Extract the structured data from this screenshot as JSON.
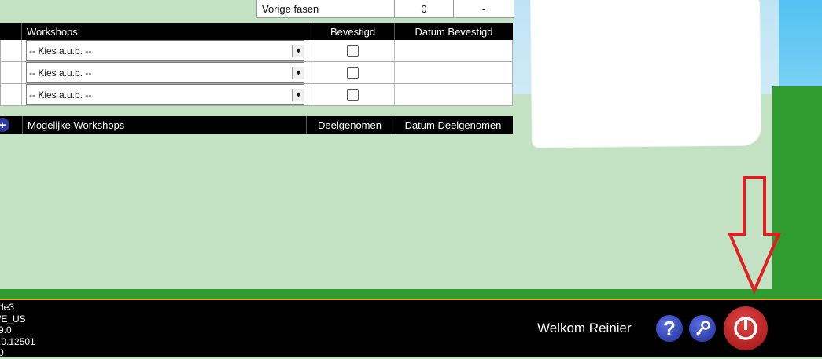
{
  "top_table": {
    "label": "Vorige fasen",
    "count": "0",
    "date": "-"
  },
  "workshops_table": {
    "headers": [
      "Workshops",
      "Bevestigd",
      "Datum Bevestigd"
    ],
    "rows": [
      {
        "select": "-- Kies a.u.b. --",
        "confirmed": false,
        "date": ""
      },
      {
        "select": "-- Kies a.u.b. --",
        "confirmed": false,
        "date": ""
      },
      {
        "select": "-- Kies a.u.b. --",
        "confirmed": false,
        "date": ""
      }
    ]
  },
  "possible_table": {
    "add_icon": "plus-icon",
    "headers": [
      "Mogelijke Workshops",
      "Deelgenomen",
      "Datum Deelgenomen"
    ]
  },
  "footer": {
    "version_lines": [
      "de3",
      "/E_US",
      "9.0",
      ".0.12501",
      "0"
    ],
    "welcome": "Welkom Reinier",
    "help_icon": "question-icon",
    "key_icon": "key-icon",
    "power_icon": "power-icon"
  },
  "colors": {
    "annotation_arrow": "#e02020",
    "accent_line": "#e2a217",
    "header_bg": "#000000"
  }
}
